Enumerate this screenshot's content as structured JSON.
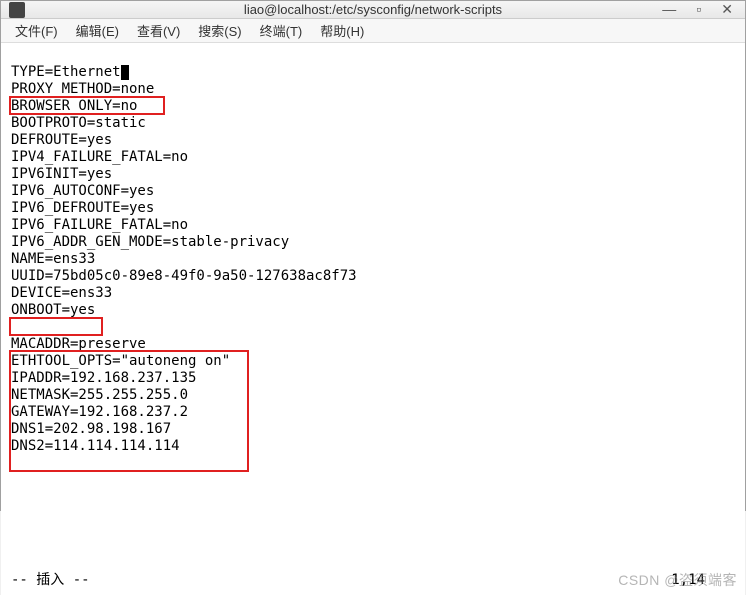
{
  "titlebar": {
    "title": "liao@localhost:/etc/sysconfig/network-scripts"
  },
  "menubar": {
    "items": [
      "文件(F)",
      "编辑(E)",
      "查看(V)",
      "搜索(S)",
      "终端(T)",
      "帮助(H)"
    ]
  },
  "config": {
    "lines": [
      "TYPE=Ethernet",
      "PROXY_METHOD=none",
      "BROWSER_ONLY=no",
      "BOOTPROTO=static",
      "DEFROUTE=yes",
      "IPV4_FAILURE_FATAL=no",
      "IPV6INIT=yes",
      "IPV6_AUTOCONF=yes",
      "IPV6_DEFROUTE=yes",
      "IPV6_FAILURE_FATAL=no",
      "IPV6_ADDR_GEN_MODE=stable-privacy",
      "NAME=ens33",
      "UUID=75bd05c0-89e8-49f0-9a50-127638ac8f73",
      "DEVICE=ens33",
      "ONBOOT=yes",
      "",
      "MACADDR=preserve",
      "ETHTOOL_OPTS=\"autoneng on\"",
      "IPADDR=192.168.237.135",
      "NETMASK=255.255.255.0",
      "GATEWAY=192.168.237.2",
      "DNS1=202.98.198.167",
      "DNS2=114.114.114.114"
    ]
  },
  "status": {
    "mode": "-- 插入 --",
    "position": "1,14"
  },
  "watermark": "CSDN @盗须端客"
}
